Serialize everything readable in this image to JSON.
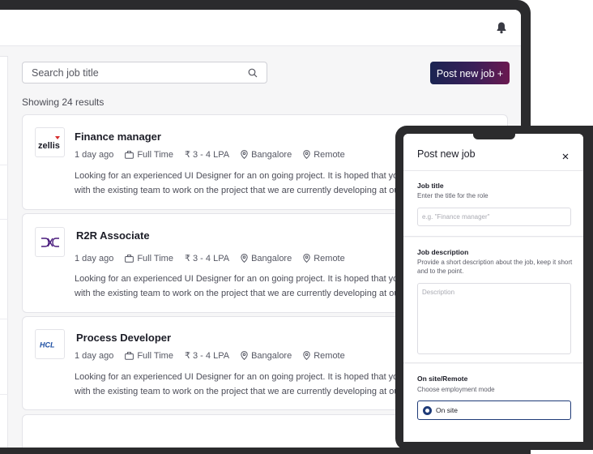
{
  "header": {
    "notification_icon": "bell-icon"
  },
  "search": {
    "placeholder": "Search job title",
    "icon": "search-icon"
  },
  "actions": {
    "post_job_label": "Post new job +"
  },
  "results_label": "Showing 24 results",
  "jobs": [
    {
      "company_logo": "zellis",
      "title": "Finance manager",
      "posted": "1 day ago",
      "type": "Full Time",
      "salary": "₹ 3 - 4 LPA",
      "location": "Bangalore",
      "mode": "Remote",
      "desc_line1": "Looking for an experienced UI Designer for an on going project. It is hoped that you w",
      "desc_line2": "with the existing team to work on the project that we are currently developing at our"
    },
    {
      "company_logo": "DXC",
      "title": "R2R Associate",
      "posted": "1 day ago",
      "type": "Full Time",
      "salary": "₹ 3 - 4 LPA",
      "location": "Bangalore",
      "mode": "Remote",
      "desc_line1": "Looking for an experienced UI Designer for an on going project. It is hoped that you w",
      "desc_line2": "with the existing team to work on the project that we are currently developing at our"
    },
    {
      "company_logo": "HCL",
      "title": "Process Developer",
      "posted": "1 day ago",
      "type": "Full Time",
      "salary": "₹ 3 - 4 LPA",
      "location": "Bangalore",
      "mode": "Remote",
      "desc_line1": "Looking for an experienced UI Designer for an on going project. It is hoped that you w",
      "desc_line2": "with the existing team to work on the project that we are currently developing at our"
    }
  ],
  "modal": {
    "title": "Post new job",
    "job_title": {
      "label": "Job title",
      "help": "Enter the title for the role",
      "placeholder": "e.g. \"Finance manager\""
    },
    "job_description": {
      "label": "Job description",
      "help": "Provide a short description about the job, keep it short and to the point.",
      "placeholder": "Description"
    },
    "onsite": {
      "label": "On site/Remote",
      "help": "Choose employment mode",
      "selected_option": "On site"
    }
  },
  "colors": {
    "accent_start": "#1b2452",
    "accent_end": "#6a1950",
    "radio": "#1f3b78",
    "frame": "#2b2b2d"
  }
}
